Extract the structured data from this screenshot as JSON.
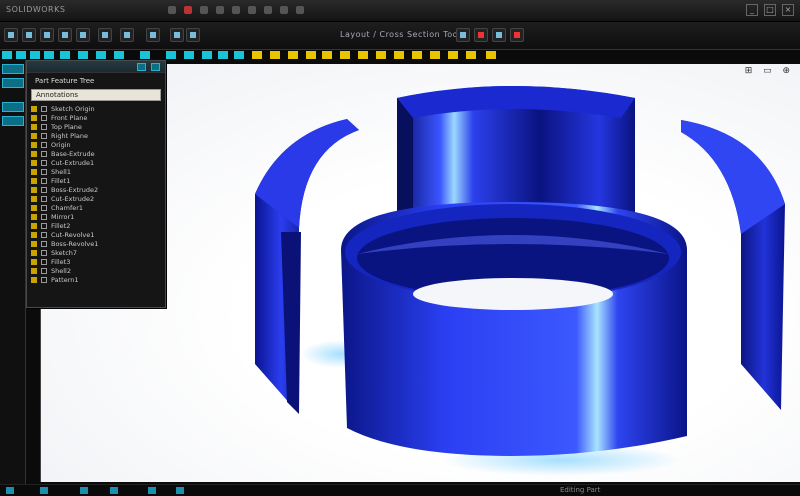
{
  "window": {
    "title": "SOLIDWORKS",
    "controls": [
      "_",
      "□",
      "×"
    ]
  },
  "toolbar": {
    "coordinate_readout": "Layout / Cross Section Tools"
  },
  "viewport": {
    "view_controls": "⊞ ▭ ⊕"
  },
  "panel": {
    "title": "Part Feature Tree",
    "field_value": "Annotations",
    "tree_items": [
      "Sketch Origin",
      "Front Plane",
      "Top Plane",
      "Right Plane",
      "Origin",
      "Base-Extrude",
      "Cut-Extrude1",
      "Shell1",
      "Fillet1",
      "Boss-Extrude2",
      "Cut-Extrude2",
      "Chamfer1",
      "Mirror1",
      "Fillet2",
      "Cut-Revolve1",
      "Boss-Revolve1",
      "Sketch7",
      "Fillet3",
      "Shell2",
      "Pattern1"
    ]
  },
  "status": {
    "text": "Editing Part"
  },
  "colors": {
    "part_blue": "#1f2fd0",
    "highlight": "#5cc6ff",
    "swatch_cyan": "#18c4d8",
    "swatch_yellow": "#e8c400"
  }
}
